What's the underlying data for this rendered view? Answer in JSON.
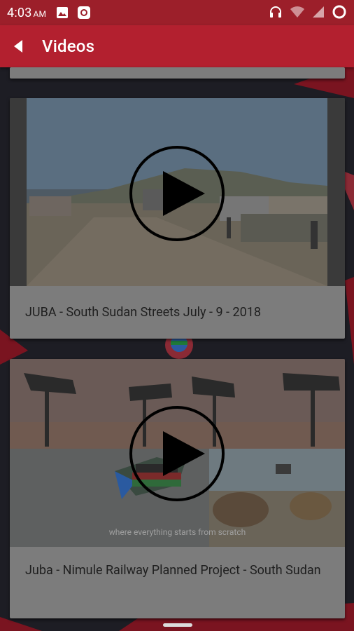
{
  "status_bar": {
    "time": "4:03",
    "ampm": "AM",
    "icons": [
      "image-icon",
      "app-notification-icon",
      "headset-icon",
      "wifi-icon",
      "signal-icon",
      "circle-icon"
    ]
  },
  "app_bar": {
    "title": "Videos",
    "back_icon": "back-arrow-icon"
  },
  "videos": [
    {
      "title": "JUBA - South Sudan Streets July - 9 - 2018"
    },
    {
      "title": "Juba - Nimule Railway Planned Project - South Sudan",
      "overlay_text": "where everything starts from scratch"
    }
  ],
  "colors": {
    "status_bar": "#9c1f2a",
    "app_bar": "#b3202f",
    "card": "#7c7c7c",
    "background": "#1d1d24"
  }
}
